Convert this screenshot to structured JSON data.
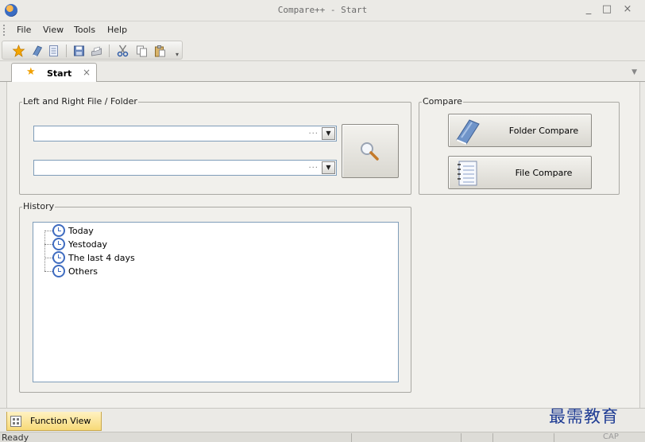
{
  "window": {
    "title": "Compare++ - Start",
    "minimize_glyph": "_",
    "maximize_glyph": "□",
    "close_glyph": "×"
  },
  "menu": {
    "file": "File",
    "view": "View",
    "tools": "Tools",
    "help": "Help"
  },
  "toolbar": {
    "icons": [
      "star-icon",
      "folder-compare-icon",
      "file-compare-icon",
      "save-icon",
      "print-icon",
      "cut-icon",
      "copy-icon",
      "paste-icon"
    ]
  },
  "tabs": {
    "start": "Start",
    "close_glyph": "×"
  },
  "files": {
    "legend": "Left and Right File / Folder",
    "left_path": "",
    "right_path": "",
    "browse_dots": "..."
  },
  "compare": {
    "legend": "Compare",
    "folder_compare": "Folder Compare",
    "file_compare": "File Compare"
  },
  "history": {
    "legend": "History",
    "items": [
      "Today",
      "Yestoday",
      "The last 4 days",
      "Others"
    ]
  },
  "bottom": {
    "function_view": "Function View",
    "status": "Ready",
    "cap": "CAP"
  },
  "watermark": "最需教育",
  "colors": {
    "accent": "#3f6cc0",
    "tab_highlight": "#f7d978",
    "background": "#ebeae6"
  }
}
